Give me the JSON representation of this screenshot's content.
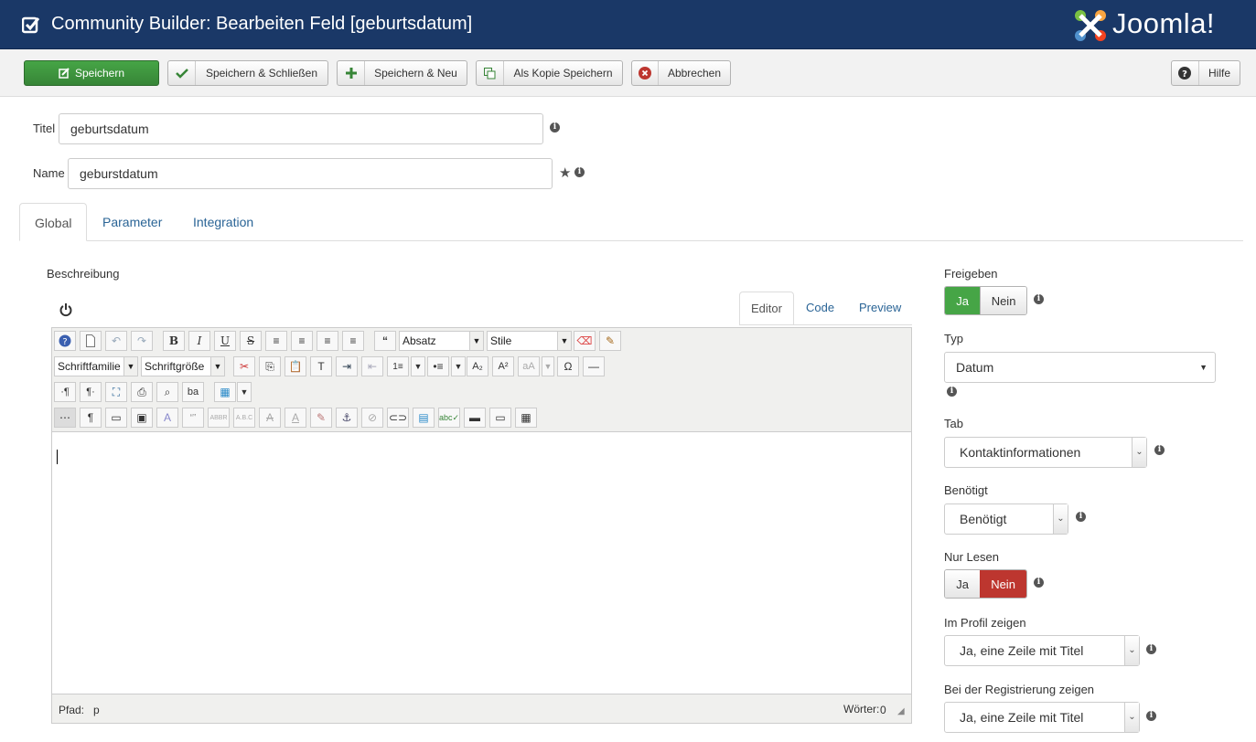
{
  "header": {
    "title": "Community Builder: Bearbeiten Feld [geburtsdatum]",
    "brand": "Joomla!"
  },
  "toolbar": {
    "save": "Speichern",
    "save_close": "Speichern & Schließen",
    "save_new": "Speichern & Neu",
    "save_copy": "Als Kopie Speichern",
    "cancel": "Abbrechen",
    "help": "Hilfe"
  },
  "form": {
    "title_label": "Titel",
    "title_value": "geburtsdatum",
    "name_label": "Name",
    "name_value": "geburstdatum"
  },
  "tabs": [
    "Global",
    "Parameter",
    "Integration"
  ],
  "editor": {
    "section_label": "Beschreibung",
    "tabs": [
      "Editor",
      "Code",
      "Preview"
    ],
    "format_select": "Absatz",
    "style_select": "Stile",
    "font_family": "Schriftfamilie",
    "font_size": "Schriftgröße",
    "path_label": "Pfad:",
    "path_value": "p",
    "words_label": "Wörter:",
    "words_value": "0"
  },
  "sidebar": {
    "published": {
      "label": "Freigeben",
      "yes": "Ja",
      "no": "Nein",
      "value": "Ja"
    },
    "type": {
      "label": "Typ",
      "value": "Datum"
    },
    "tab": {
      "label": "Tab",
      "value": "Kontaktinformationen"
    },
    "required": {
      "label": "Benötigt",
      "value": "Benötigt"
    },
    "readonly": {
      "label": "Nur Lesen",
      "yes": "Ja",
      "no": "Nein",
      "value": "Nein"
    },
    "profile": {
      "label": "Im Profil zeigen",
      "value": "Ja, eine Zeile mit Titel"
    },
    "registration": {
      "label": "Bei der Registrierung zeigen",
      "value": "Ja, eine Zeile mit Titel"
    }
  },
  "colors": {
    "header": "#1a3867",
    "success": "#46a546",
    "danger": "#bd362f",
    "link": "#2a6496"
  }
}
